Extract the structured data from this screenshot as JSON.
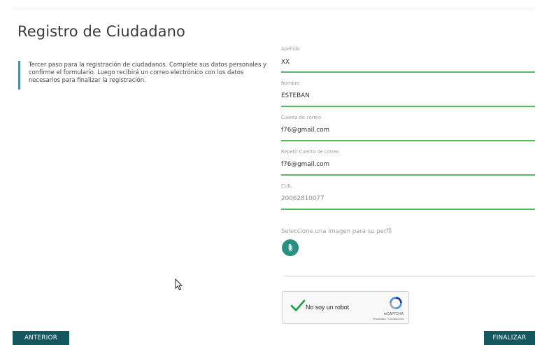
{
  "page": {
    "title": "Registro de Ciudadano",
    "intro": "Tercer paso para la registración de ciudadanos. Complete sus datos personales y confirme el formulario. Luego recibirá un correo electrónico con los datos necesarios para finalizar la registración."
  },
  "form": {
    "fields": [
      {
        "label": "Apellido",
        "value": "XX"
      },
      {
        "label": "Nombre",
        "value": "ESTEBAN"
      },
      {
        "label": "Cuenta de correo",
        "value": "f76@gmail.com"
      },
      {
        "label": "Repetir Cuenta de correo",
        "value": "f76@gmail.com"
      },
      {
        "label": "CUIL",
        "value": "20062810077"
      }
    ],
    "image_label": "Seleccione una imagen para su perfil"
  },
  "captcha": {
    "label": "No soy un robot",
    "brand": "reCAPTCHA",
    "terms": "Privacidad - Condiciones",
    "checked": true
  },
  "buttons": {
    "previous": "ANTERIOR",
    "finish": "FINALIZAR"
  },
  "colors": {
    "accent": "#14575f",
    "field_underline": "#5cb85c",
    "attach": "#2a8f7f",
    "intro_bar": "#4a8f96"
  },
  "icons": {
    "attach": "paperclip-icon",
    "captcha_check": "check-icon",
    "captcha_logo": "recaptcha-logo-icon",
    "cursor": "mouse-pointer-icon"
  }
}
